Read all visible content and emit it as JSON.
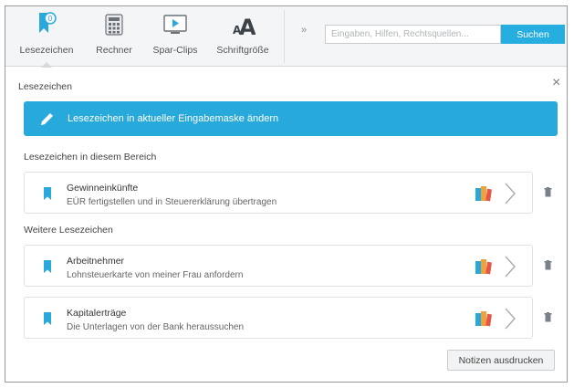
{
  "toolbar": {
    "tools": [
      {
        "label": "Lesezeichen",
        "icon": "bookmark-icon"
      },
      {
        "label": "Rechner",
        "icon": "calculator-icon"
      },
      {
        "label": "Spar-Clips",
        "icon": "video-clip-icon"
      },
      {
        "label": "Schriftgröße",
        "icon": "font-size-icon"
      }
    ],
    "more_icon": "double-chevron-right-icon",
    "search_placeholder": "Eingaben, Hilfen, Rechtsquellen...",
    "search_button": "Suchen"
  },
  "panel": {
    "title": "Lesezeichen",
    "banner_label": "Lesezeichen in aktueller Eingabemaske ändern",
    "section_current": "Lesezeichen in diesem Bereich",
    "section_more": "Weitere Lesezeichen",
    "print_button": "Notizen ausdrucken"
  },
  "bookmarks_current": [
    {
      "title": "Gewinneinkünfte",
      "note": "EÜR fertigstellen und in Steuererklärung übertragen"
    }
  ],
  "bookmarks_more": [
    {
      "title": "Arbeitnehmer",
      "note": "Lohnsteuerkarte von meiner Frau anfordern"
    },
    {
      "title": "Kapitalerträge",
      "note": "Die Unterlagen von der Bank heraussuchen"
    }
  ],
  "colors": {
    "accent": "#28a9dc",
    "search_button": "#27aee0",
    "bookmark_icon": "#2aa8db"
  }
}
